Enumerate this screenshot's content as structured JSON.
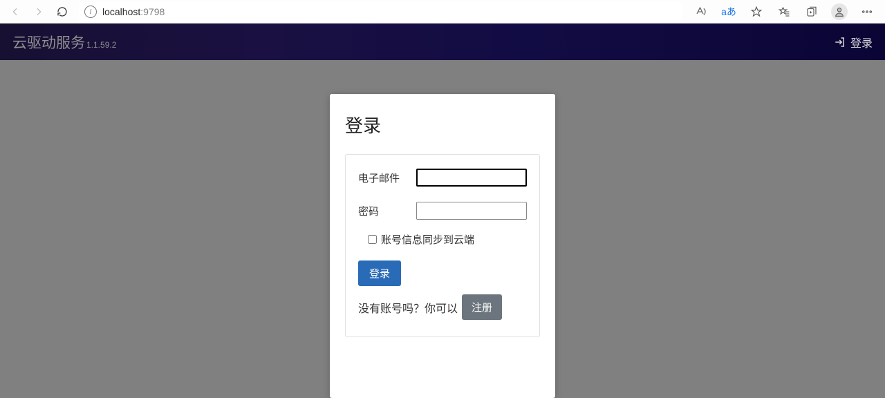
{
  "browser": {
    "url_host": "localhost",
    "url_port": ":9798",
    "translate_label": "aあ"
  },
  "header": {
    "app_name": "云驱动服务",
    "version": "1.1.59.2",
    "login_link": "登录"
  },
  "login_card": {
    "title": "登录",
    "email_label": "电子邮件",
    "password_label": "密码",
    "sync_label": "账号信息同步到云端",
    "submit_label": "登录",
    "no_account_text": "没有账号吗？你可以",
    "register_label": "注册"
  }
}
